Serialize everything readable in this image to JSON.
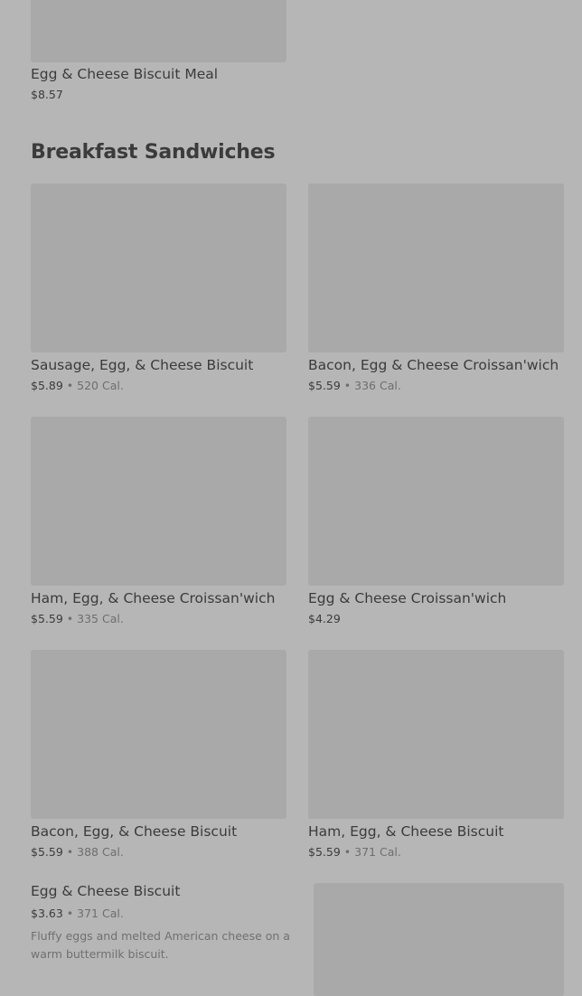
{
  "top_item": {
    "name": "Egg & Cheese Biscuit Meal",
    "price": "$8.57"
  },
  "section": {
    "title": "Breakfast Sandwiches"
  },
  "items": [
    {
      "name": "Sausage, Egg, & Cheese Biscuit",
      "price": "$5.89",
      "separator": "•",
      "calories": "520 Cal."
    },
    {
      "name": "Bacon, Egg & Cheese Croissan'wich",
      "price": "$5.59",
      "separator": "•",
      "calories": "336 Cal."
    },
    {
      "name": "Ham, Egg, & Cheese Croissan'wich",
      "price": "$5.59",
      "separator": "•",
      "calories": "335 Cal."
    },
    {
      "name": "Egg & Cheese Croissan'wich",
      "price": "$4.29"
    },
    {
      "name": "Bacon, Egg, & Cheese Biscuit",
      "price": "$5.59",
      "separator": "•",
      "calories": "388 Cal."
    },
    {
      "name": "Ham, Egg, & Cheese Biscuit",
      "price": "$5.59",
      "separator": "•",
      "calories": "371 Cal."
    }
  ],
  "featured_item": {
    "name": "Egg & Cheese Biscuit",
    "price": "$3.63",
    "separator": "•",
    "calories": "371 Cal.",
    "description": "Fluffy eggs and melted American cheese on a warm buttermilk biscuit."
  },
  "colors": {
    "overlay_background": "#b6b6b6",
    "image_placeholder": "#a9a9a9",
    "text_primary": "#3b3b3b",
    "text_secondary": "#6e6e6e"
  }
}
